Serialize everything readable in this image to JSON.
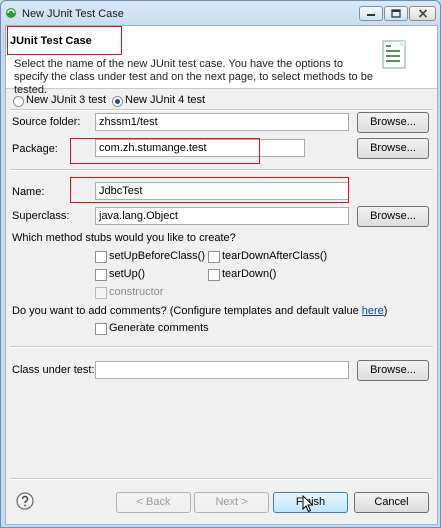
{
  "window": {
    "title": "New JUnit Test Case"
  },
  "banner": {
    "title": "JUnit Test Case",
    "description": "Select the name of the new JUnit test case. You have the options to specify the class under test and on the next page, to select methods to be tested."
  },
  "version": {
    "junit3_label": "New JUnit 3 test",
    "junit4_label": "New JUnit 4 test",
    "selected": "New JUnit 4 test"
  },
  "source_folder": {
    "label": "Source folder:",
    "value": "zhssm1/test",
    "browse": "Browse..."
  },
  "package": {
    "label": "Package:",
    "value": "com.zh.stumange.test",
    "browse": "Browse..."
  },
  "name": {
    "label": "Name:",
    "value": "JdbcTest"
  },
  "superclass": {
    "label": "Superclass:",
    "value": "java.lang.Object",
    "browse": "Browse..."
  },
  "stubs": {
    "question": "Which method stubs would you like to create?",
    "setUpBeforeClass": "setUpBeforeClass()",
    "tearDownAfterClass": "tearDownAfterClass()",
    "setUp": "setUp()",
    "tearDown": "tearDown()",
    "constructor": "constructor"
  },
  "comments": {
    "question_prefix": "Do you want to add comments? (Configure templates and default value ",
    "link": "here",
    "question_suffix": ")",
    "generate": "Generate comments"
  },
  "class_under_test": {
    "label": "Class under test:",
    "value": "",
    "browse": "Browse..."
  },
  "footer": {
    "back": "< Back",
    "next": "Next >",
    "finish": "Finish",
    "cancel": "Cancel"
  },
  "colors": {
    "highlight": "#dd1111",
    "link": "#0645ad"
  }
}
